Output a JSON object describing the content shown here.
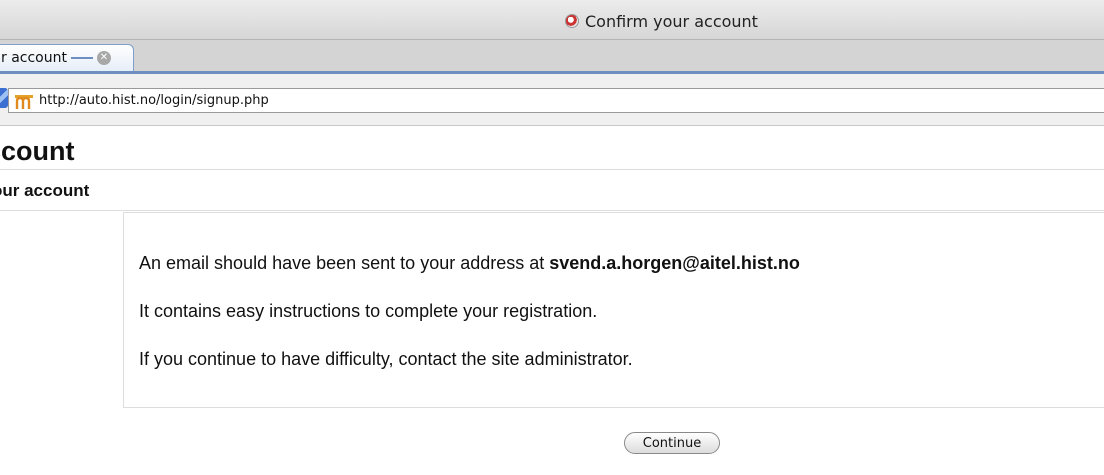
{
  "window": {
    "title": "Confirm your account"
  },
  "tab": {
    "label": "r account",
    "close_icon": "close-icon"
  },
  "addressbar": {
    "url": "http://auto.hist.no/login/signup.php",
    "site_icon": "moodle-icon"
  },
  "page": {
    "heading": "ccount",
    "subheading": "our account",
    "message": {
      "line1_prefix": "An email should have been sent to your address at ",
      "email": "svend.a.horgen@aitel.hist.no",
      "line2": "It contains easy instructions to complete your registration.",
      "line3": "If you continue to have difficulty, contact the site administrator."
    },
    "continue_label": "Continue"
  }
}
